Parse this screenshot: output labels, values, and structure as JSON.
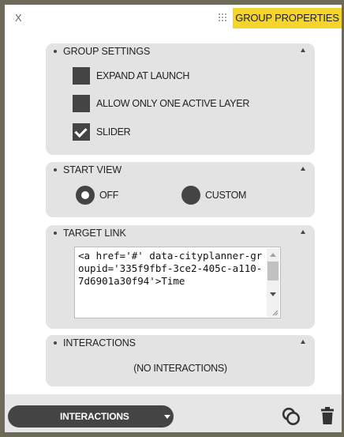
{
  "window": {
    "close_label": "X",
    "title": "GROUP PROPERTIES"
  },
  "group_settings": {
    "header": "GROUP SETTINGS",
    "options": [
      {
        "label": "EXPAND AT LAUNCH",
        "checked": false
      },
      {
        "label": "ALLOW ONLY ONE ACTIVE LAYER",
        "checked": false
      },
      {
        "label": "SLIDER",
        "checked": true
      }
    ]
  },
  "start_view": {
    "header": "START VIEW",
    "options": [
      {
        "label": "OFF",
        "selected": true
      },
      {
        "label": "CUSTOM",
        "selected": false
      }
    ]
  },
  "target_link": {
    "header": "TARGET LINK",
    "value": "<a href='#' data-cityplanner-groupid='335f9fbf-3ce2-405c-a110-7d6901a30f94'>Time"
  },
  "interactions": {
    "header": "INTERACTIONS",
    "empty_text": "(NO INTERACTIONS)"
  },
  "footer": {
    "interactions_button": "INTERACTIONS"
  },
  "colors": {
    "accent": "#f5d52c",
    "section_bg": "#e3e3e3",
    "control_dark": "#444444"
  }
}
